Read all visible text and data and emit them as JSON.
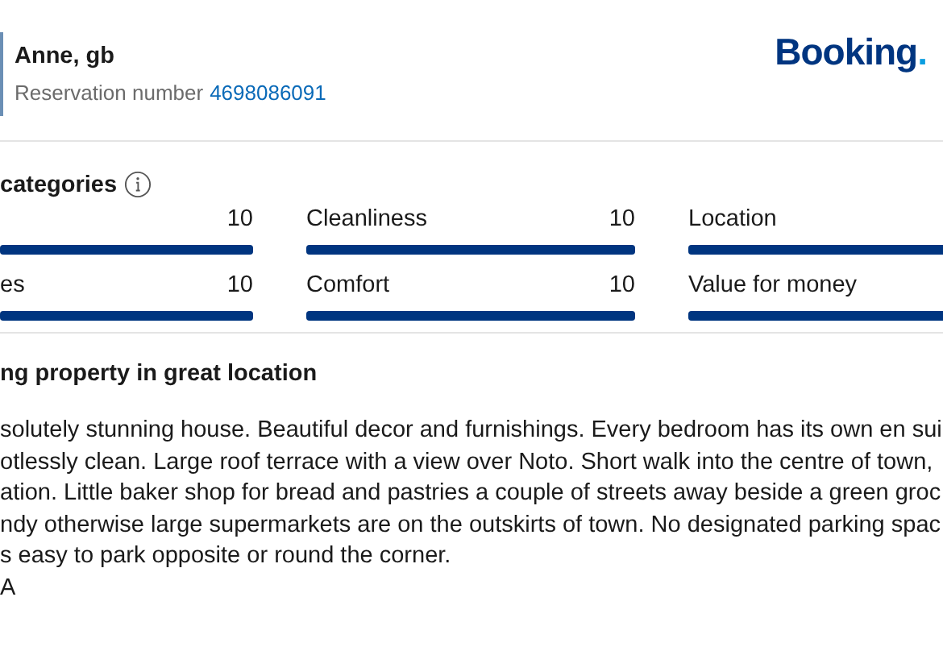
{
  "guest": {
    "name": "Anne, gb",
    "reservation_label": "Reservation number",
    "reservation_number": "4698086091"
  },
  "logo": {
    "main": "Booking",
    "suffix": "."
  },
  "categories": {
    "title": "categories",
    "items": [
      {
        "score": "10",
        "level": 1
      },
      {
        "label": "Cleanliness",
        "score": "10",
        "level": 1
      },
      {
        "label": "Location",
        "level": 1
      },
      {
        "label": "es",
        "score": "10",
        "level": 1
      },
      {
        "label": "Comfort",
        "score": "10",
        "level": 1
      },
      {
        "label": "Value for money",
        "level": 1
      }
    ]
  },
  "review": {
    "title": "ng property in great location",
    "lines": [
      "solutely stunning house. Beautiful decor and furnishings. Every bedroom has its own en sui",
      "otlessly clean. Large roof terrace with a view over Noto. Short walk into the centre of town,",
      "ation. Little baker shop for bread and pastries a couple of streets away beside a green groc",
      "ndy otherwise large supermarkets are on the outskirts of town. No designated parking spac",
      "s easy to park opposite or round the corner.",
      "A"
    ]
  }
}
